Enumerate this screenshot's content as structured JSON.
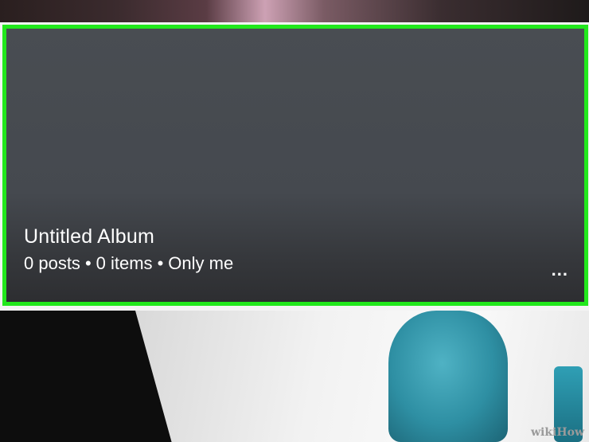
{
  "album": {
    "title": "Untitled Album",
    "posts": "0 posts",
    "items": "0 items",
    "privacy": "Only me",
    "separator": "•",
    "more_label": "..."
  },
  "watermark": "wikiHow",
  "colors": {
    "highlight_border": "#22e81c",
    "card_background": "#45494f",
    "text": "#ffffff"
  },
  "icons": {
    "more": "more-options-icon"
  }
}
